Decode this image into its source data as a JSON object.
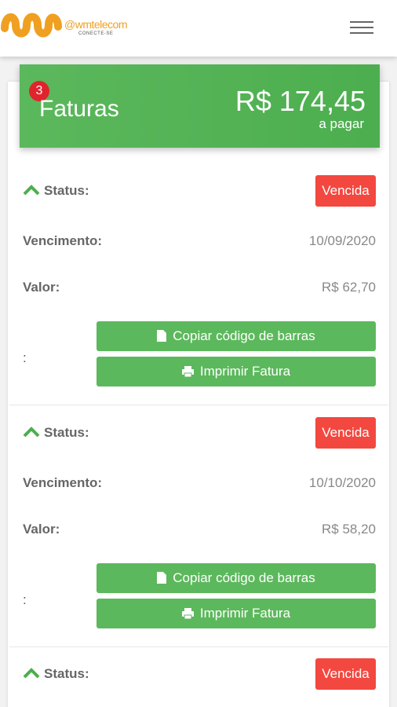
{
  "brand": {
    "name": "@wmtelecom",
    "tagline": "CONECTE-SE",
    "colors": {
      "logo": "#f0a020",
      "primary": "#5cb85c",
      "danger": "#f24840",
      "badge": "#e0242c"
    }
  },
  "header": {
    "badge_count": "3",
    "title": "Faturas",
    "amount": "R$ 174,45",
    "amount_label": "a pagar"
  },
  "invoices": [
    {
      "status_label": "Status:",
      "status": "Vencida",
      "due_label": "Vencimento:",
      "due_date": "10/09/2020",
      "value_label": "Valor:",
      "value": "R$ 62,70",
      "colon": ":",
      "copy_barcode": "Copiar código de barras",
      "print": "Imprimir Fatura"
    },
    {
      "status_label": "Status:",
      "status": "Vencida",
      "due_label": "Vencimento:",
      "due_date": "10/10/2020",
      "value_label": "Valor:",
      "value": "R$ 58,20",
      "colon": ":",
      "copy_barcode": "Copiar código de barras",
      "print": "Imprimir Fatura"
    },
    {
      "status_label": "Status:",
      "status": "Vencida"
    }
  ],
  "icons": [
    "logo-icon",
    "menu-icon",
    "chevron-up-icon",
    "file-icon",
    "print-icon"
  ]
}
